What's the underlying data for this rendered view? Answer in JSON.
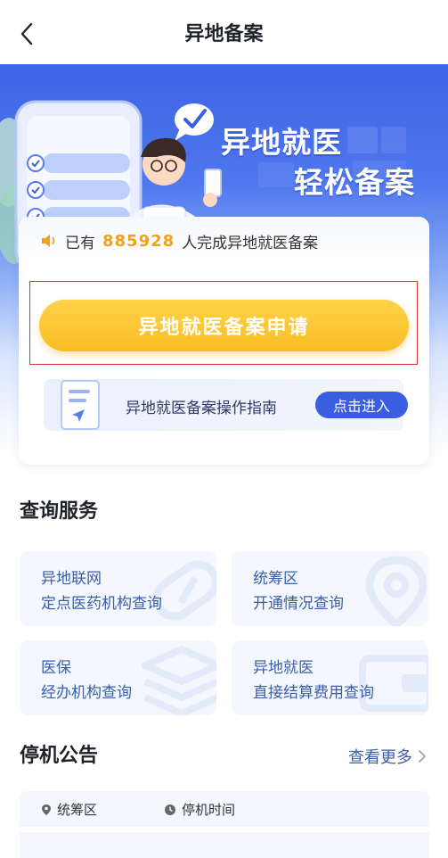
{
  "header": {
    "title": "异地备案",
    "back_icon": "chevron-left-icon"
  },
  "hero": {
    "title_line1": "异地就医",
    "title_line2": "轻松备案"
  },
  "stats": {
    "prefix": "已有",
    "count": "885928",
    "suffix": "人完成异地就医备案",
    "icon": "speaker-icon"
  },
  "actions": {
    "apply_label": "异地就医备案申请",
    "guide_label": "异地就医备案操作指南",
    "guide_enter_label": "点击进入"
  },
  "query_section": {
    "title": "查询服务",
    "items": [
      {
        "line1": "异地联网",
        "line2": "定点医药机构查询",
        "icon": "pill-icon"
      },
      {
        "line1": "统筹区",
        "line2": "开通情况查询",
        "icon": "location-pin-icon"
      },
      {
        "line1": "医保",
        "line2": "经办机构查询",
        "icon": "layers-icon"
      },
      {
        "line1": "异地就医",
        "line2": "直接结算费用查询",
        "icon": "wallet-icon"
      }
    ]
  },
  "notice_section": {
    "title": "停机公告",
    "more_label": "查看更多",
    "columns": [
      "统筹区",
      "停机时间"
    ]
  },
  "colors": {
    "brand_blue": "#3b5de0",
    "accent_yellow": "#f9bd22",
    "count_orange": "#f2a21a",
    "link_blue": "#3a5ea8"
  }
}
